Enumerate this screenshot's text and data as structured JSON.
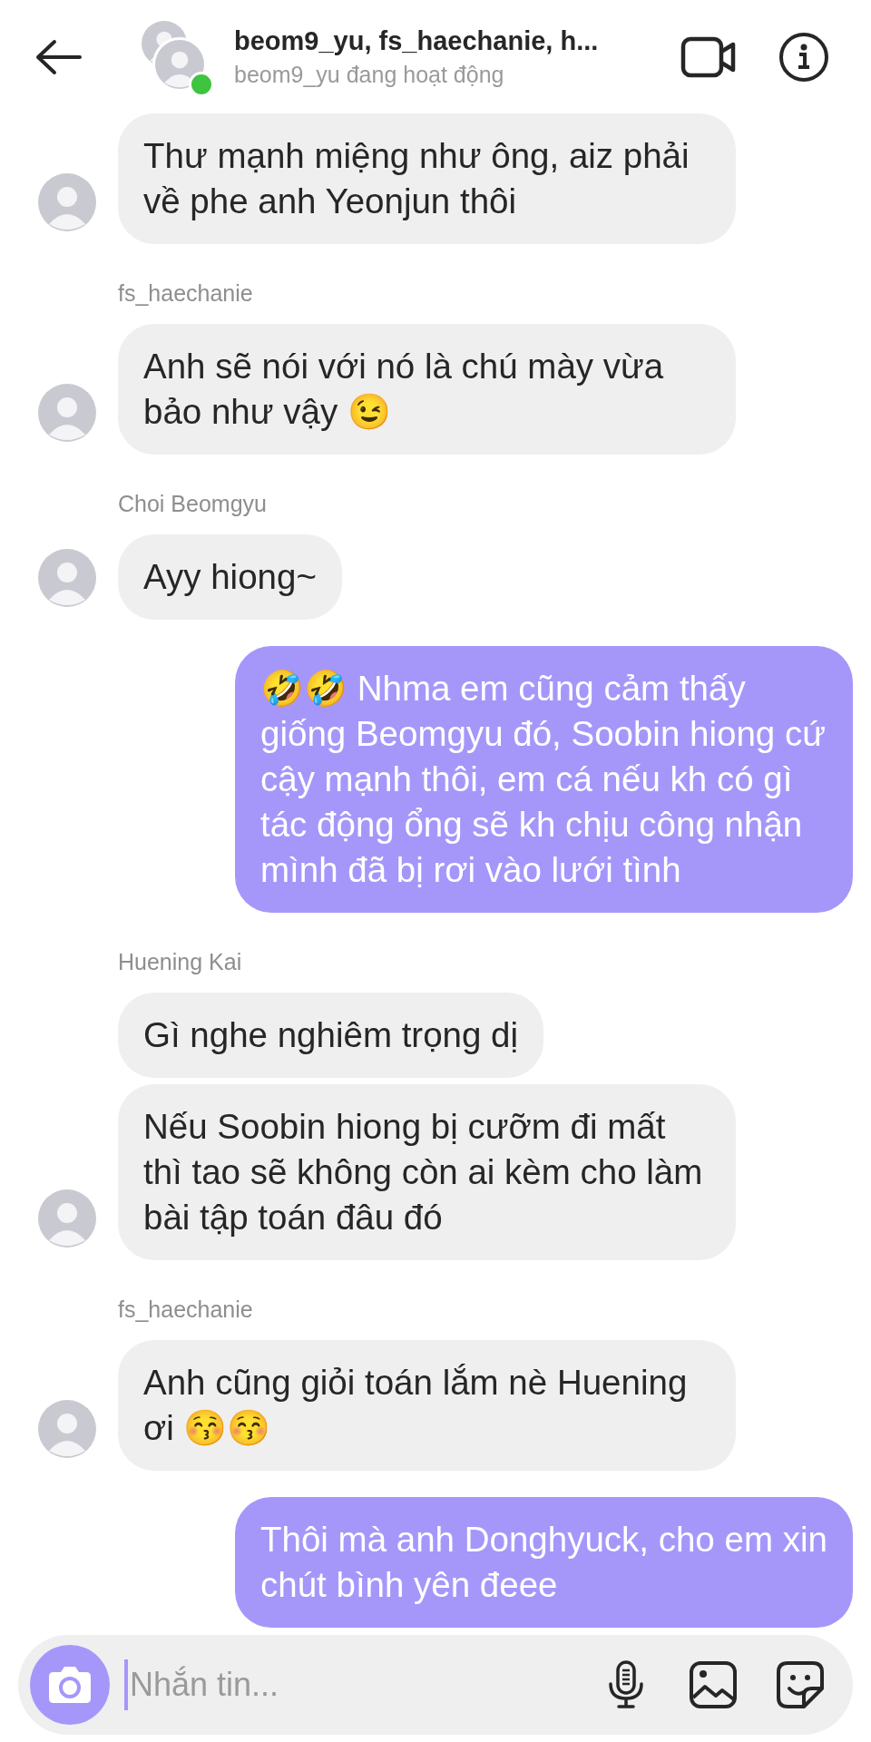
{
  "header": {
    "title": "beom9_yu, fs_haechanie, h...",
    "status": "beom9_yu đang hoạt động",
    "online": true
  },
  "messages": [
    {
      "kind": "received",
      "bubbles": [
        "Thư mạnh miệng như ông, aiz phải về phe anh Yeonjun thôi"
      ]
    },
    {
      "kind": "received",
      "sender": "fs_haechanie",
      "bubbles": [
        "Anh sẽ nói với nó là chú mày vừa bảo như vậy 😉"
      ]
    },
    {
      "kind": "received",
      "sender": "Choi Beomgyu",
      "bubbles": [
        "Ayy hiong~"
      ]
    },
    {
      "kind": "sent",
      "bubbles": [
        "🤣🤣 Nhma em cũng cảm thấy giống Beomgyu đó, Soobin hiong cứ cậy mạnh thôi, em cá nếu kh có gì tác động ổng sẽ kh chịu công nhận mình đã bị rơi vào lưới tình"
      ]
    },
    {
      "kind": "received",
      "sender": "Huening Kai",
      "bubbles": [
        "Gì nghe nghiêm trọng dị",
        "Nếu Soobin hiong bị cưỡm đi mất thì tao sẽ không còn ai kèm cho làm bài tập toán đâu đó"
      ]
    },
    {
      "kind": "received",
      "sender": "fs_haechanie",
      "bubbles": [
        "Anh cũng giỏi toán lắm nè Huening ơi 😚😚"
      ]
    },
    {
      "kind": "sent",
      "bubbles": [
        "Thôi mà anh Donghyuck, cho em xin chút bình yên đeee"
      ]
    }
  ],
  "composer": {
    "placeholder": "Nhắn tin..."
  }
}
